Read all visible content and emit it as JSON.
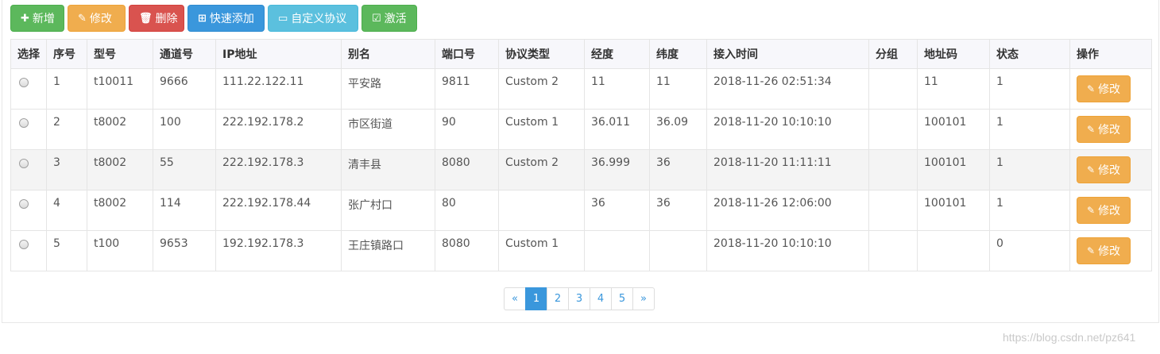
{
  "toolbar": {
    "add": "新增",
    "edit": "修改",
    "delete": "删除",
    "quick_add": "快速添加",
    "custom_protocol": "自定义协议",
    "activate": "激活"
  },
  "table": {
    "headers": [
      "选择",
      "序号",
      "型号",
      "通道号",
      "IP地址",
      "别名",
      "端口号",
      "协议类型",
      "经度",
      "纬度",
      "接入时间",
      "分组",
      "地址码",
      "状态",
      "操作"
    ],
    "rows": [
      [
        "1",
        "t10011",
        "9666",
        "111.22.122.11",
        "平安路",
        "9811",
        "Custom 2",
        "11",
        "11",
        "2018-11-26 02:51:34",
        "",
        "11",
        "1"
      ],
      [
        "2",
        "t8002",
        "100",
        "222.192.178.2",
        "市区街道",
        "90",
        "Custom 1",
        "36.011",
        "36.09",
        "2018-11-20 10:10:10",
        "",
        "100101",
        "1"
      ],
      [
        "3",
        "t8002",
        "55",
        "222.192.178.3",
        "清丰县",
        "8080",
        "Custom 2",
        "36.999",
        "36",
        "2018-11-20 11:11:11",
        "",
        "100101",
        "1"
      ],
      [
        "4",
        "t8002",
        "114",
        "222.192.178.44",
        "张广村口",
        "80",
        "",
        "36",
        "36",
        "2018-11-26 12:06:00",
        "",
        "100101",
        "1"
      ],
      [
        "5",
        "t100",
        "9653",
        "192.192.178.3",
        "王庄镇路口",
        "8080",
        "Custom 1",
        "",
        "",
        "2018-11-20 10:10:10",
        "",
        "",
        "0"
      ]
    ],
    "row_edit_label": "修改"
  },
  "pagination": {
    "prev": "«",
    "pages": [
      "1",
      "2",
      "3",
      "4",
      "5"
    ],
    "next": "»",
    "current": "1"
  },
  "watermark": "https://blog.csdn.net/pz641",
  "colors": {
    "success": "#5cb85c",
    "warning": "#f0ad4e",
    "danger": "#d9534f",
    "primary": "#3a97dc",
    "info": "#5bc0de"
  }
}
